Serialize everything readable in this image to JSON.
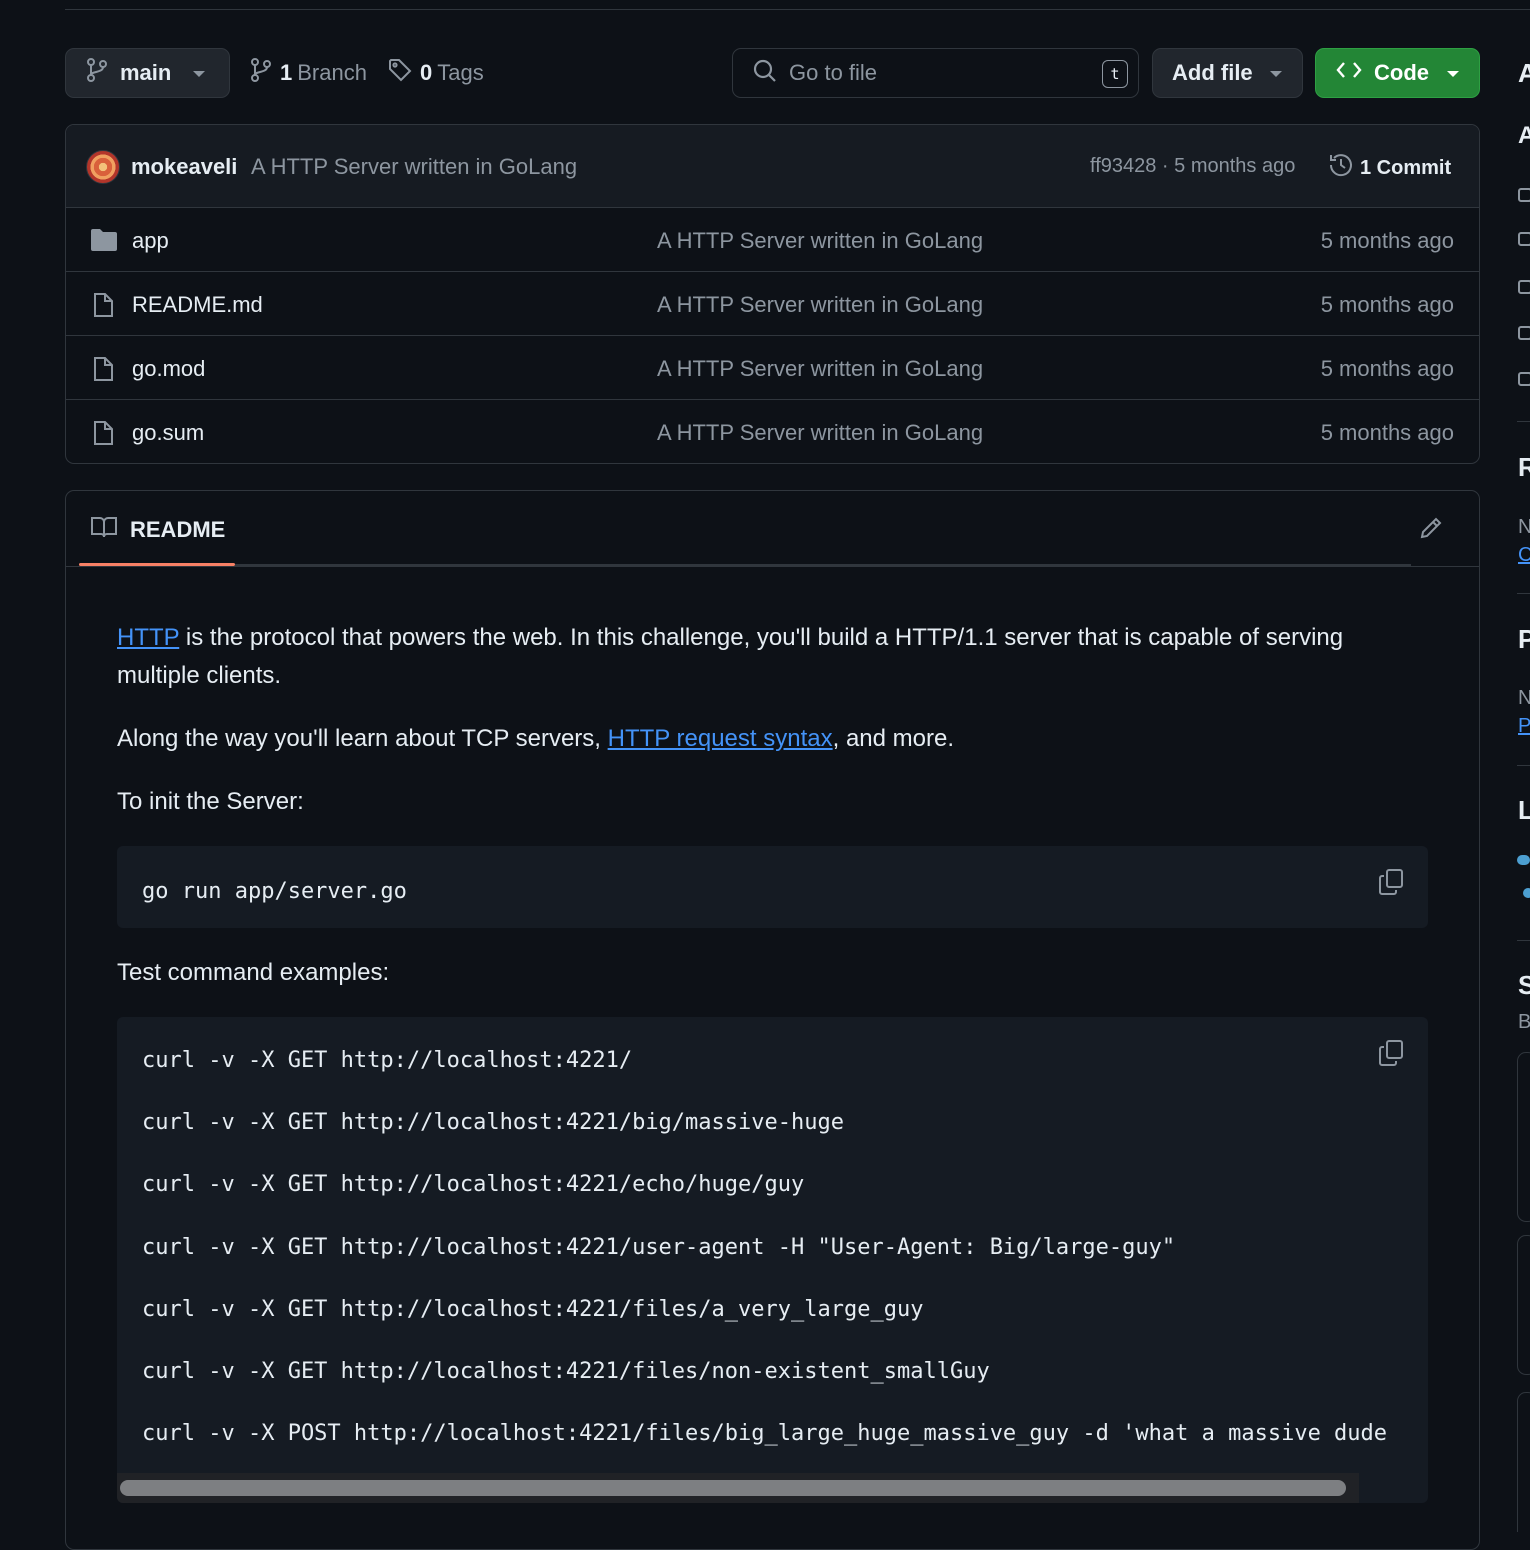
{
  "toolbar": {
    "branch": "main",
    "branch_count": "1",
    "branch_label": "Branch",
    "tag_count": "0",
    "tag_label": "Tags",
    "search_placeholder": "Go to file",
    "search_shortcut": "t",
    "add_file_label": "Add file",
    "code_label": "Code",
    "code_button_color": "#238636"
  },
  "latest_commit": {
    "author": "mokeaveli",
    "message": "A HTTP Server written in GoLang",
    "hash_and_time": "ff93428 · 5 months ago",
    "commit_count_label": "1 Commit"
  },
  "files": [
    {
      "name": "app",
      "type": "folder",
      "message": "A HTTP Server written in GoLang",
      "date": "5 months ago"
    },
    {
      "name": "README.md",
      "type": "file",
      "message": "A HTTP Server written in GoLang",
      "date": "5 months ago"
    },
    {
      "name": "go.mod",
      "type": "file",
      "message": "A HTTP Server written in GoLang",
      "date": "5 months ago"
    },
    {
      "name": "go.sum",
      "type": "file",
      "message": "A HTTP Server written in GoLang",
      "date": "5 months ago"
    }
  ],
  "readme": {
    "tab_label": "README",
    "p1_link": "HTTP",
    "p1_rest": " is the protocol that powers the web. In this challenge, you'll build a HTTP/1.1 server that is capable of serving multiple clients.",
    "p2_start": "Along the way you'll learn about TCP servers, ",
    "p2_link": "HTTP request syntax",
    "p2_end": ", and more.",
    "p3": "To init the Server:",
    "init_code": "go run app/server.go",
    "p4": "Test command examples:",
    "test_commands": [
      "curl -v -X GET http://localhost:4221/",
      "curl -v -X GET http://localhost:4221/big/massive-huge",
      "curl -v -X GET http://localhost:4221/echo/huge/guy",
      "curl -v -X GET http://localhost:4221/user-agent -H \"User-Agent: Big/large-guy\"",
      "curl -v -X GET http://localhost:4221/files/a_very_large_guy",
      "curl -v -X GET http://localhost:4221/files/non-existent_smallGuy",
      "curl -v -X POST http://localhost:4221/files/big_large_huge_massive_guy -d 'what a massive dude"
    ]
  },
  "sidebar": {
    "about_h": "A",
    "about_t": "A",
    "readme_h": "R",
    "readme_t": "N",
    "readme_link": "C",
    "packages_h": "P",
    "packages_t": "N",
    "packages_link": "P",
    "languages_h": "L",
    "s_h": "S",
    "s_t": "B"
  },
  "colors": {
    "background": "#0d1117",
    "link": "#4493f8",
    "tab_accent": "#f78166"
  }
}
